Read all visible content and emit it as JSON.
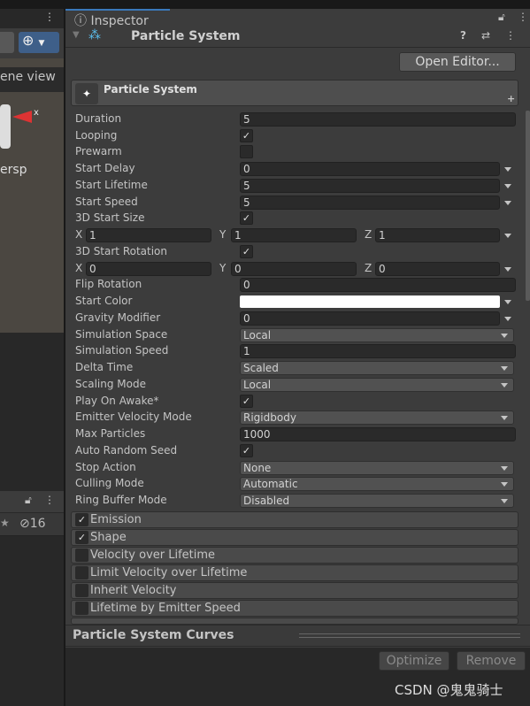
{
  "left_panel": {
    "scene_label": "ene view",
    "persp_label": "ersp",
    "axis_label": "x",
    "hidden_count": "16"
  },
  "inspector": {
    "tab": "Inspector",
    "component_title": "Particle System",
    "open_editor": "Open Editor...",
    "module_main": "Particle System"
  },
  "rows": [
    {
      "label": "Duration",
      "type": "text",
      "value": "5"
    },
    {
      "label": "Looping",
      "type": "check",
      "checked": true
    },
    {
      "label": "Prewarm",
      "type": "check",
      "checked": false
    },
    {
      "label": "Start Delay",
      "type": "curve",
      "value": "0"
    },
    {
      "label": "Start Lifetime",
      "type": "curve",
      "value": "5"
    },
    {
      "label": "Start Speed",
      "type": "curve",
      "value": "5"
    },
    {
      "label": "3D Start Size",
      "type": "check",
      "checked": true
    },
    {
      "label": "",
      "type": "xyz",
      "x": "1",
      "y": "1",
      "z": "1"
    },
    {
      "label": "3D Start Rotation",
      "type": "check",
      "checked": true
    },
    {
      "label": "",
      "type": "xyz",
      "x": "0",
      "y": "0",
      "z": "0"
    },
    {
      "label": "Flip Rotation",
      "type": "text",
      "value": "0"
    },
    {
      "label": "Start Color",
      "type": "color",
      "value": "#ffffff"
    },
    {
      "label": "Gravity Modifier",
      "type": "curve",
      "value": "0"
    },
    {
      "label": "Simulation Space",
      "type": "select",
      "value": "Local"
    },
    {
      "label": "Simulation Speed",
      "type": "text",
      "value": "1"
    },
    {
      "label": "Delta Time",
      "type": "select",
      "value": "Scaled"
    },
    {
      "label": "Scaling Mode",
      "type": "select",
      "value": "Local"
    },
    {
      "label": "Play On Awake*",
      "type": "check",
      "checked": true
    },
    {
      "label": "Emitter Velocity Mode",
      "type": "select",
      "value": "Rigidbody"
    },
    {
      "label": "Max Particles",
      "type": "text",
      "value": "1000"
    },
    {
      "label": "Auto Random Seed",
      "type": "check",
      "checked": true
    },
    {
      "label": "Stop Action",
      "type": "select",
      "value": "None"
    },
    {
      "label": "Culling Mode",
      "type": "select",
      "value": "Automatic"
    },
    {
      "label": "Ring Buffer Mode",
      "type": "select",
      "value": "Disabled"
    }
  ],
  "xyz_labels": [
    "X",
    "Y",
    "Z"
  ],
  "modules": [
    {
      "label": "Emission",
      "checked": true
    },
    {
      "label": "Shape",
      "checked": true
    },
    {
      "label": "Velocity over Lifetime",
      "checked": false
    },
    {
      "label": "Limit Velocity over Lifetime",
      "checked": false
    },
    {
      "label": "Inherit Velocity",
      "checked": false
    },
    {
      "label": "Lifetime by Emitter Speed",
      "checked": false
    }
  ],
  "curves": {
    "title": "Particle System Curves",
    "optimize": "Optimize",
    "remove": "Remove"
  },
  "watermark": "CSDN @鬼鬼骑士"
}
